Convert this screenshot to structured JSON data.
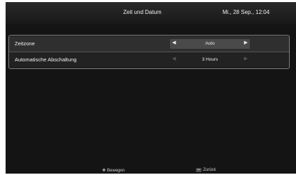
{
  "header": {
    "title": "Zeit und Datum",
    "datetime": "Mi., 28 Sep., 12:04"
  },
  "settings": [
    {
      "label": "Zeitzone",
      "value": "Auto"
    },
    {
      "label": "Automatische Abschaltung",
      "value": "3 Hours"
    }
  ],
  "footer": {
    "move_label": "Bewegen",
    "back_label": "Zurück",
    "move_icon": "four-way-arrows-icon",
    "back_icon": "return-icon"
  }
}
